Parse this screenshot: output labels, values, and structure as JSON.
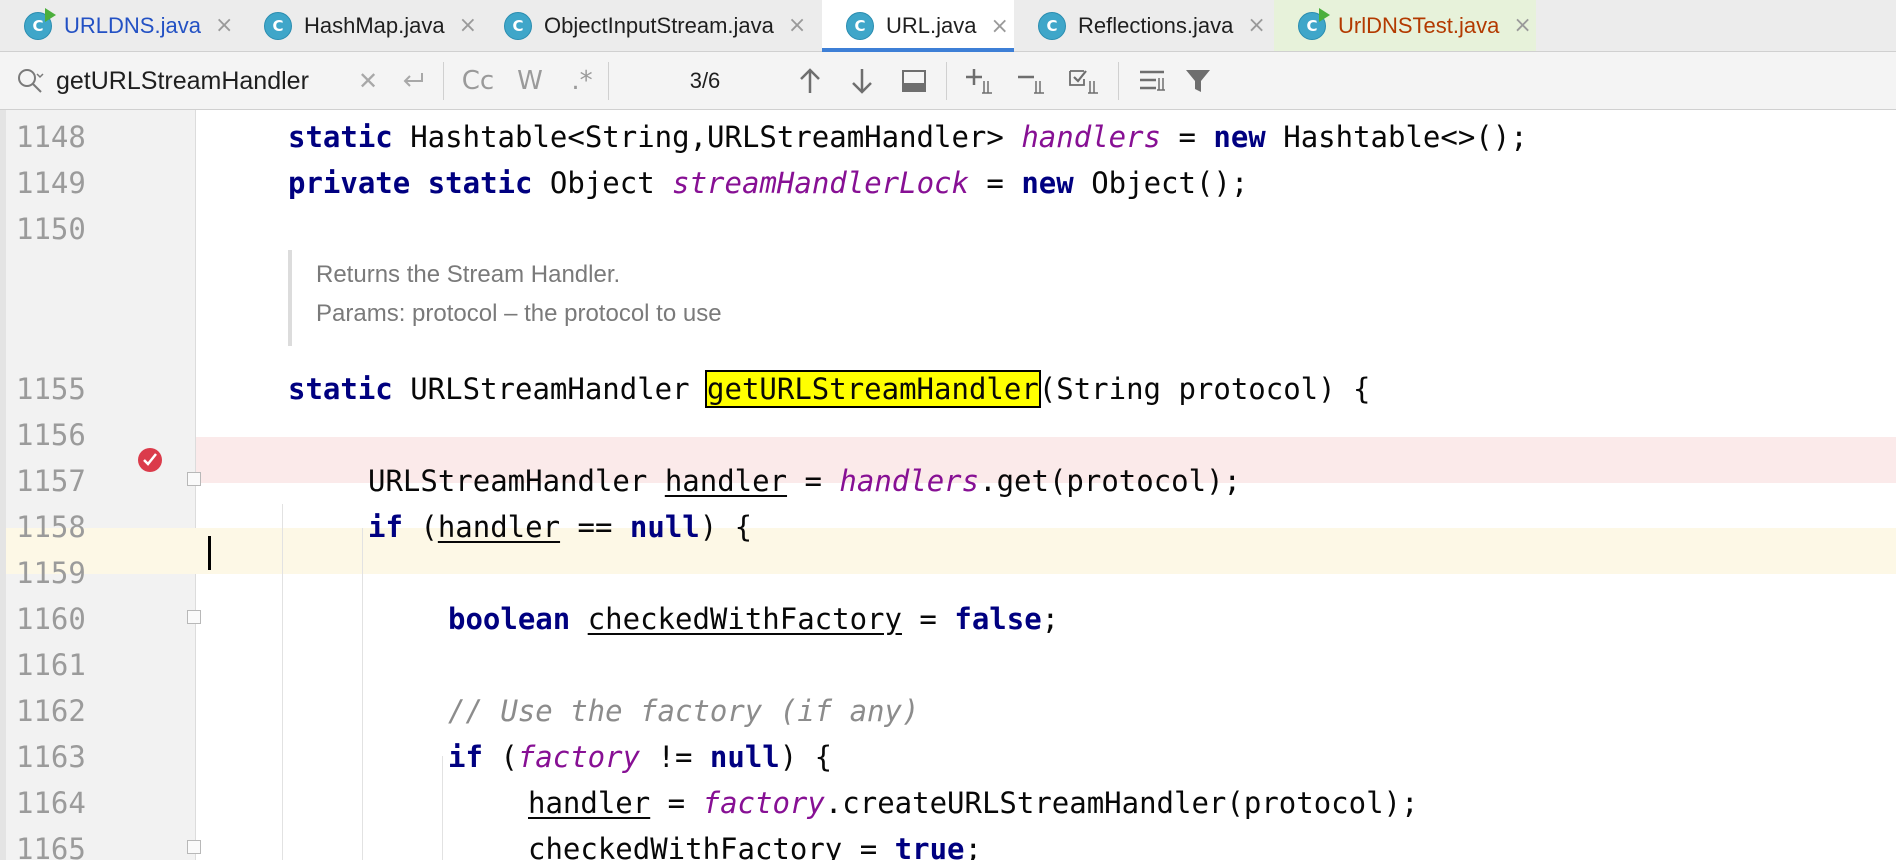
{
  "tabs": [
    {
      "label": "URLDNS.java",
      "color": "#2351c4",
      "run": true
    },
    {
      "label": "HashMap.java",
      "color": "#1f1f1f",
      "run": false
    },
    {
      "label": "ObjectInputStream.java",
      "color": "#1f1f1f",
      "run": false
    },
    {
      "label": "URL.java",
      "color": "#1f1f1f",
      "run": false
    },
    {
      "label": "Reflections.java",
      "color": "#1f1f1f",
      "run": false
    },
    {
      "label": "UrlDNSTest.java",
      "color": "#b33a00",
      "run": true
    }
  ],
  "tab_icon_letter": "C",
  "tab_close": "×",
  "search": {
    "value": "getURLStreamHandler",
    "match_case": "Cc",
    "words": "W",
    "regex": ".*",
    "count": "3/6"
  },
  "doc": {
    "line1": "Returns the Stream Handler.",
    "line2": "Params: protocol – the protocol to use"
  },
  "lines": [
    {
      "no": "1148"
    },
    {
      "no": "1149"
    },
    {
      "no": "1150"
    },
    {
      "no": "1155"
    },
    {
      "no": "1156"
    },
    {
      "no": "1157"
    },
    {
      "no": "1158"
    },
    {
      "no": "1159"
    },
    {
      "no": "1160"
    },
    {
      "no": "1161"
    },
    {
      "no": "1162"
    },
    {
      "no": "1163"
    },
    {
      "no": "1164"
    },
    {
      "no": "1165"
    }
  ],
  "code": {
    "l1148": {
      "kw1": "static",
      "t1": " Hashtable<String,URLStreamHandler> ",
      "f1": "handlers",
      "t2": " = ",
      "kw2": "new",
      "t3": " Hashtable<>();"
    },
    "l1149": {
      "kw1": "private",
      "t1": " ",
      "kw2": "static",
      "t2": " Object ",
      "f1": "streamHandlerLock",
      "t3": " = ",
      "kw3": "new",
      "t4": " Object();"
    },
    "l1155": {
      "kw1": "static",
      "t1": " URLStreamHandler ",
      "m1": "getURLStreamHandler",
      "t2": "(String protocol) {"
    },
    "l1157": {
      "t1": "URLStreamHandler ",
      "u1": "handler",
      "t2": " = ",
      "f1": "handlers",
      "t3": ".get(protocol);"
    },
    "l1158": {
      "kw1": "if",
      "t1": " (",
      "u1": "handler",
      "t2": " == ",
      "kw2": "null",
      "t3": ") {"
    },
    "l1160": {
      "kw1": "boolean",
      "t1": " ",
      "u1": "checkedWithFactory",
      "t2": " = ",
      "kw2": "false",
      "t3": ";"
    },
    "l1162": {
      "c1": "// Use the factory (if any)"
    },
    "l1163": {
      "kw1": "if",
      "t1": " (",
      "f1": "factory",
      "t2": " != ",
      "kw2": "null",
      "t3": ") {"
    },
    "l1164": {
      "u1": "handler",
      "t1": " = ",
      "f1": "factory",
      "t2": ".createURLStreamHandler(protocol);"
    },
    "l1165": {
      "u1": "checkedWithFactory",
      "t1": " = ",
      "kw1": "true",
      "t2": ";"
    }
  },
  "colors": {
    "accent": "#3d7fd6",
    "breakpoint_line": "#fbeaea",
    "caret_line": "#fdf8e6",
    "match": "#ffff00",
    "breakpoint": "#db3b4b"
  }
}
